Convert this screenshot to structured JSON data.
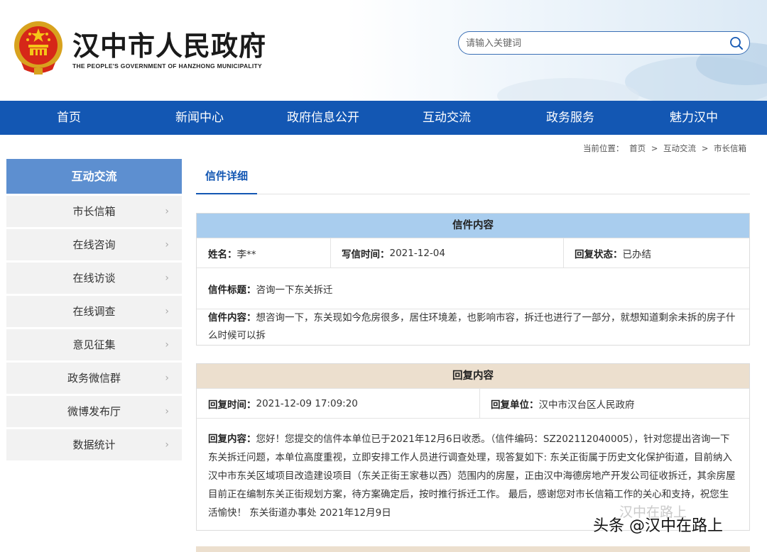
{
  "header": {
    "title": "汉中市人民政府",
    "subtitle": "THE PEOPLE'S GOVERNMENT OF HANZHONG MUNICIPALITY",
    "search_placeholder": "请输入关键词"
  },
  "nav": {
    "items": [
      "首页",
      "新闻中心",
      "政府信息公开",
      "互动交流",
      "政务服务",
      "魅力汉中"
    ]
  },
  "breadcrumb": {
    "prefix": "当前位置：",
    "items": [
      "首页",
      "互动交流",
      "市长信箱"
    ],
    "separator": ">"
  },
  "sidebar": {
    "heading": "互动交流",
    "items": [
      "市长信箱",
      "在线咨询",
      "在线访谈",
      "在线调查",
      "意见征集",
      "政务微信群",
      "微博发布厅",
      "数据统计"
    ]
  },
  "tab": {
    "active_label": "信件详细"
  },
  "letter": {
    "heading": "信件内容",
    "name_label": "姓名：",
    "name_value": "李**",
    "time_label": "写信时间：",
    "time_value": "2021-12-04",
    "status_label": "回复状态：",
    "status_value": "已办结",
    "subject_label": "信件标题：",
    "subject_value": "咨询一下东关拆迁",
    "content_label": "信件内容：",
    "content_value": "想咨询一下，东关现如今危房很多，居住环境差，也影响市容，拆迁也进行了一部分，就想知道剩余未拆的房子什么时候可以拆"
  },
  "reply": {
    "heading": "回复内容",
    "time_label": "回复时间：",
    "time_value": "2021-12-09 17:09:20",
    "unit_label": "回复单位：",
    "unit_value": "汉中市汉台区人民政府",
    "content_label": "回复内容：",
    "content_value": "您好！您提交的信件本单位已于2021年12月6日收悉。（信件编码：SZ202112040005），针对您提出咨询一下东关拆迁问题，本单位高度重视，立即安排工作人员进行调查处理，现答复如下: 东关正街属于历史文化保护街道，目前纳入汉中市东关区域项目改造建设项目（东关正街王家巷以西）范围内的房屋，正由汉中海德房地产开发公司征收拆迁，其余房屋目前正在编制东关正街规划方案，待方案确定后，按时推行拆迁工作。 最后，感谢您对市长信箱工作的关心和支持，祝您生活愉快！ 东关街道办事处 2021年12月9日"
  },
  "watermark": {
    "text": "头条 @汉中在路上",
    "faint_text": "汉中在路上"
  },
  "colors": {
    "nav": "#1357b3",
    "sidebar_head": "#5d8fd0",
    "letter_head": "#a9cdee",
    "reply_head": "#ecdfce"
  }
}
